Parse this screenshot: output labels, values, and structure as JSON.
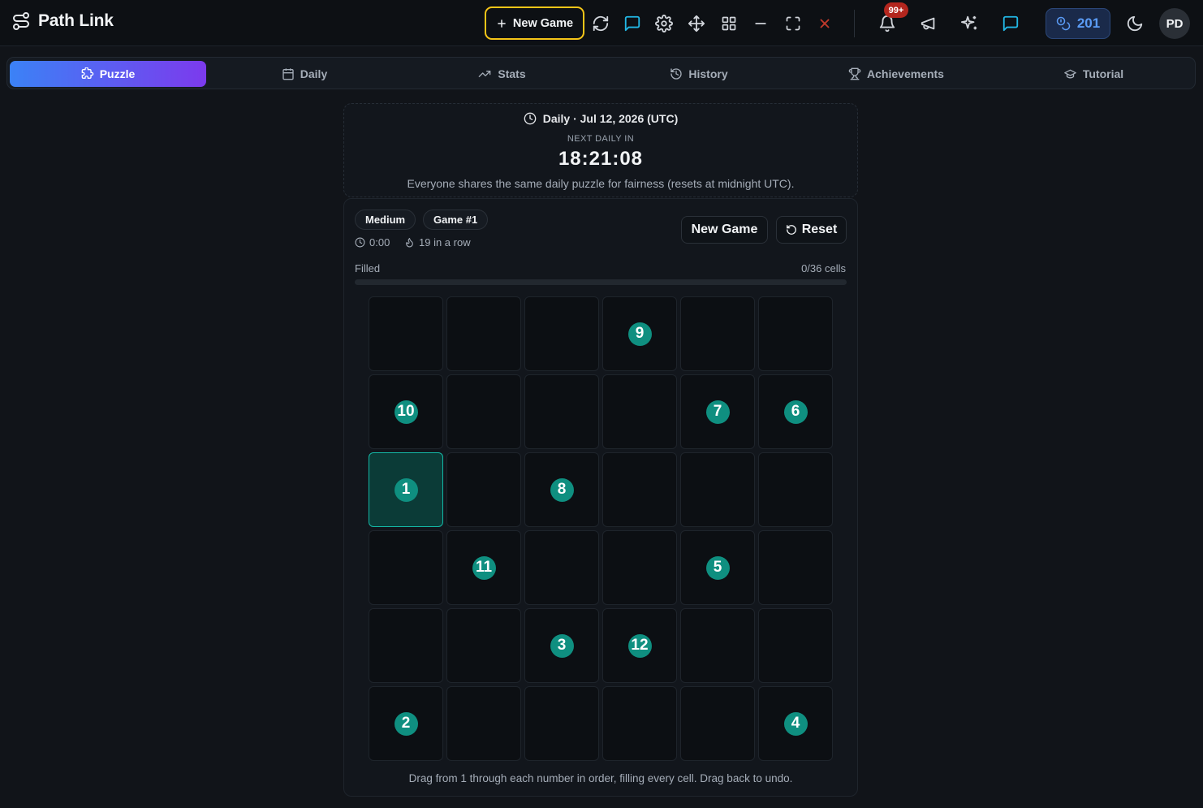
{
  "app": {
    "title": "Path Link"
  },
  "topbar": {
    "new_game_label": "New Game",
    "notification_badge": "99+",
    "coins": "201",
    "avatar_initials": "PD",
    "icons": [
      "refresh-icon",
      "chat-icon",
      "gear-icon",
      "move-icon",
      "grid-icon",
      "minimize-icon",
      "fullscreen-icon",
      "close-icon",
      "bell-icon",
      "megaphone-icon",
      "sparkles-icon",
      "message-icon",
      "moon-icon"
    ]
  },
  "tabs": [
    {
      "label": "Puzzle",
      "icon": "puzzle-icon",
      "active": true
    },
    {
      "label": "Daily",
      "icon": "calendar-icon",
      "active": false
    },
    {
      "label": "Stats",
      "icon": "trending-icon",
      "active": false
    },
    {
      "label": "History",
      "icon": "history-icon",
      "active": false
    },
    {
      "label": "Achievements",
      "icon": "trophy-icon",
      "active": false
    },
    {
      "label": "Tutorial",
      "icon": "graduation-cap-icon",
      "active": false
    }
  ],
  "daily": {
    "heading": "Daily · Jul 12, 2026 (UTC)",
    "next_label": "NEXT DAILY IN",
    "countdown": "18:21:08",
    "note": "Everyone shares the same daily puzzle for fairness (resets at midnight UTC)."
  },
  "game": {
    "difficulty": "Medium",
    "game_number": "Game #1",
    "timer": "0:00",
    "streak": "19 in a row",
    "new_game_label": "New Game",
    "reset_label": "Reset",
    "progress_label": "Filled",
    "progress_count": "0/36 cells",
    "progress_fraction": 0,
    "hint": "Drag from 1 through each number in order, filling every cell. Drag back to undo.",
    "grid": [
      [
        "",
        "",
        "",
        "9",
        "",
        ""
      ],
      [
        "10",
        "",
        "",
        "",
        "7",
        "6"
      ],
      [
        "1",
        "",
        "8",
        "",
        "",
        ""
      ],
      [
        "",
        "11",
        "",
        "",
        "5",
        ""
      ],
      [
        "",
        "",
        "3",
        "12",
        "",
        ""
      ],
      [
        "2",
        "",
        "",
        "",
        "",
        "4"
      ]
    ],
    "start_cell": [
      2,
      0
    ]
  },
  "colors": {
    "accent_yellow": "#f5c518",
    "teal": "#0f8f80",
    "tab_gradient_start": "#3b82f6",
    "tab_gradient_end": "#7c3aed",
    "coin_blue": "#5b9cf6"
  }
}
